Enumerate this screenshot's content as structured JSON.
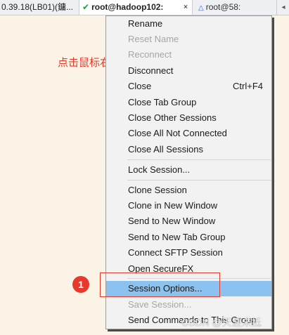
{
  "tabs": [
    {
      "label": "0.39.18(LB01)(鏞...",
      "active": false
    },
    {
      "label": "root@hadoop102:",
      "active": true,
      "close": "×"
    },
    {
      "label": "root@58:",
      "active": false
    }
  ],
  "tab_nav": "◂",
  "annotation": "点击鼠标右键",
  "menu": {
    "items": [
      {
        "label": "Rename",
        "enabled": true
      },
      {
        "label": "Reset Name",
        "enabled": false
      },
      {
        "label": "Reconnect",
        "enabled": false
      },
      {
        "label": "Disconnect",
        "enabled": true
      },
      {
        "label": "Close",
        "shortcut": "Ctrl+F4",
        "enabled": true
      },
      {
        "label": "Close Tab Group",
        "enabled": true
      },
      {
        "label": "Close Other Sessions",
        "enabled": true
      },
      {
        "label": "Close All Not Connected",
        "enabled": true
      },
      {
        "label": "Close All Sessions",
        "enabled": true
      },
      {
        "label": "Lock Session...",
        "enabled": true
      },
      {
        "label": "Clone Session",
        "enabled": true
      },
      {
        "label": "Clone in New Window",
        "enabled": true
      },
      {
        "label": "Send to New Window",
        "enabled": true
      },
      {
        "label": "Send to New Tab Group",
        "enabled": true
      },
      {
        "label": "Connect SFTP Session",
        "enabled": true
      },
      {
        "label": "Open SecureFX",
        "enabled": true
      },
      {
        "label": "Session Options...",
        "enabled": true,
        "highlighted": true
      },
      {
        "label": "Save Session...",
        "enabled": false
      },
      {
        "label": "Send Commands to This Group",
        "enabled": true
      }
    ]
  },
  "step_badge": "1",
  "watermark": "CSDN @天涯未抵"
}
